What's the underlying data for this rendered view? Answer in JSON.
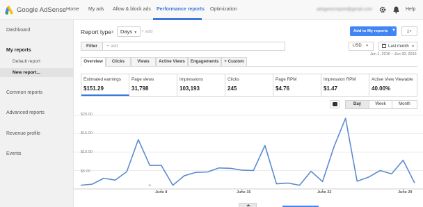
{
  "header": {
    "brand": "Google AdSense",
    "nav": [
      "Home",
      "My ads",
      "Allow & block ads",
      "Performance reports",
      "Optimization"
    ],
    "active_nav": "Performance reports",
    "email": "adsgerecreport@gmail.com",
    "help": "Help",
    "icons": [
      "gear-icon",
      "bell-icon"
    ]
  },
  "sidebar": {
    "dashboard": "Dashboard",
    "my_reports": "My reports",
    "default_report": "Default report",
    "new_report": "New report...",
    "common_reports": "Common reports",
    "advanced_reports": "Advanced reports",
    "revenue_profile": "Revenue profile",
    "events": "Events"
  },
  "report": {
    "type_label": "Report type",
    "type_value": "Days",
    "add_label": "+ add",
    "add_button": "Add to My reports",
    "filter_button": "Filter",
    "filter_placeholder": "+ add",
    "currency": "USD",
    "period": "Last month",
    "date_range": "Jun 1, 2016 – Jun 30, 2016"
  },
  "tabs": [
    "Overview",
    "Clicks",
    "Views",
    "Active Views",
    "Engagements",
    "Custom"
  ],
  "custom_tab_icon": "+",
  "metrics": [
    {
      "label": "Estimated earnings",
      "value": "$151.29"
    },
    {
      "label": "Page views",
      "value": "31,798"
    },
    {
      "label": "Impressions",
      "value": "103,193"
    },
    {
      "label": "Clicks",
      "value": "245"
    },
    {
      "label": "Page RPM",
      "value": "$4.76"
    },
    {
      "label": "Impression RPM",
      "value": "$1.47"
    },
    {
      "label": "Active View Viewable",
      "value": "40.00%"
    }
  ],
  "granularity": [
    "Day",
    "Week",
    "Month"
  ],
  "active_granularity": "Day",
  "colors": {
    "accent": "#3c78d8",
    "button": "#4285f4",
    "line": "#5b8bd0"
  },
  "chart_data": {
    "type": "line",
    "series": [
      {
        "values": [
          1.0,
          1.3,
          2.9,
          2.4,
          4.7,
          13.4,
          6.4,
          6.4,
          1.0,
          3.6,
          4.5,
          4.6,
          5.7,
          5.6,
          5.1,
          5.0,
          11.8,
          1.4,
          1.6,
          1.0,
          4.8,
          2.0,
          11.5,
          19.2,
          2.1,
          3.2,
          5.0,
          4.1,
          7.8,
          1.6
        ]
      }
    ],
    "x_ticks": [
      "June 8",
      "June 15",
      "June 22",
      "June 29"
    ],
    "x_tick_days": [
      8,
      15,
      22,
      29
    ],
    "y_ticks": [
      "$20.00",
      "$15.00",
      "$10.00",
      "$5.00"
    ],
    "ylim": [
      0,
      20
    ],
    "grid": true
  }
}
